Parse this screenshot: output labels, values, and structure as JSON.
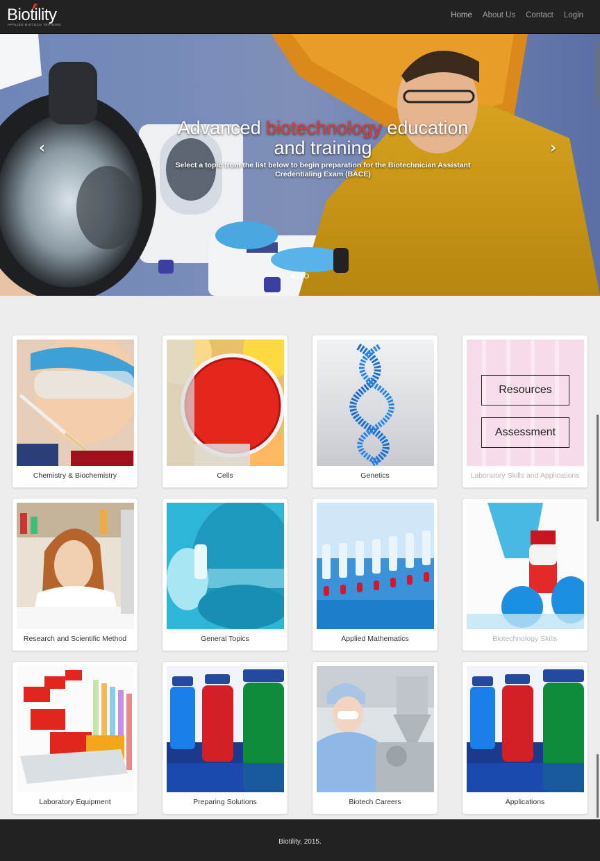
{
  "brand": {
    "name": "Biotility",
    "tagline": "APPLIED BIOTECH TRAINING"
  },
  "nav": [
    {
      "label": "Home"
    },
    {
      "label": "About Us"
    },
    {
      "label": "Contact"
    },
    {
      "label": "Login"
    }
  ],
  "hero": {
    "title_pre": "Advanced ",
    "title_highlight": "biotechnology",
    "title_post": " education and training",
    "subtitle": "Select a topic from the list below to begin preparation for the Biotechnician Assistant Credentialing Exam (BACE)",
    "prev_icon": "chevron-left-icon",
    "next_icon": "chevron-right-icon",
    "slides_count": 3,
    "active_slide": 1,
    "highlight_color": "#e53b2c"
  },
  "cards": [
    {
      "label": "Chemistry & Biochemistry",
      "muted": false
    },
    {
      "label": "Cells",
      "muted": false
    },
    {
      "label": "Genetics",
      "muted": false
    },
    {
      "label": "Laboratory Skills and Applications",
      "muted": true,
      "overlay": [
        "Resources",
        "Assessment"
      ]
    },
    {
      "label": "Research and Scientific Method",
      "muted": false
    },
    {
      "label": "General Topics",
      "muted": false
    },
    {
      "label": "Applied Mathematics",
      "muted": false
    },
    {
      "label": "Biotechnology Skills",
      "muted": true
    },
    {
      "label": "Laboratory Equipment",
      "muted": false
    },
    {
      "label": "Preparing Solutions",
      "muted": false
    },
    {
      "label": "Biotech Careers",
      "muted": false
    },
    {
      "label": "Applications",
      "muted": false
    }
  ],
  "footer": {
    "text": "Biotility, 2015."
  }
}
